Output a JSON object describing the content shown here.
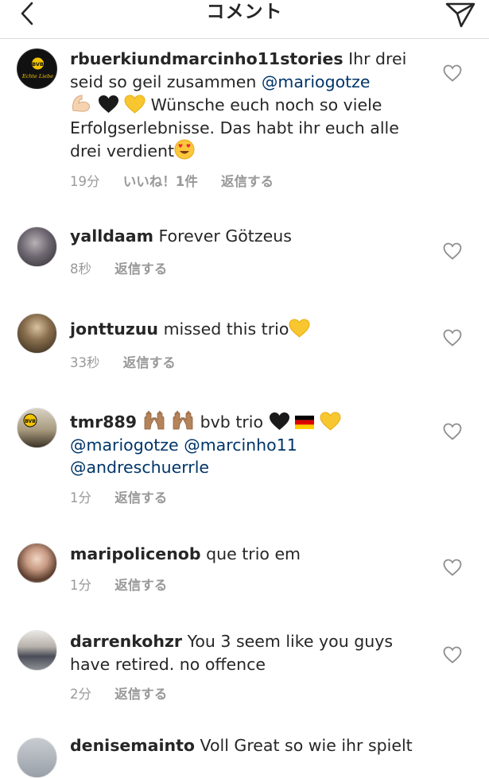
{
  "header": {
    "title": "コメント"
  },
  "icons": {
    "back": "chevron-left-icon",
    "send": "paper-plane-icon",
    "like": "heart-outline-icon"
  },
  "colors": {
    "mention": "#003569",
    "meta": "#999999",
    "text": "#262626",
    "divider": "#dbdbdb"
  },
  "comments": [
    {
      "username": "rbuerkiundmarcinho11stories",
      "text_1": "Ihr drei seid so geil zusammen",
      "mention_1": "@mariogotze",
      "text_2": "Wünsche euch noch so viele Erfolgserlebnisse. Das habt ihr euch alle drei verdient",
      "time": "19分",
      "likes": "いいね！1件",
      "reply": "返信する",
      "avatar_badge": "BVB",
      "avatar_caption": "Echte Liebe"
    },
    {
      "username": "yalldaam",
      "text_1": "Forever Götzeus",
      "time": "8秒",
      "reply": "返信する"
    },
    {
      "username": "jonttuzuu",
      "text_1": "missed this trio",
      "time": "33秒",
      "reply": "返信する"
    },
    {
      "username": "tmr889",
      "text_1": "bvb trio",
      "mention_1": "@mariogotze",
      "mention_2": "@marcinho11",
      "mention_3": "@andreschuerrle",
      "time": "1分",
      "reply": "返信する",
      "avatar_badge": "BVB"
    },
    {
      "username": "maripolicenob",
      "text_1": "que trio em",
      "time": "1分",
      "reply": "返信する"
    },
    {
      "username": "darrenkohzr",
      "text_1": "You 3 seem like you guys have retired. no offence",
      "time": "2分",
      "reply": "返信する"
    },
    {
      "username": "denisemainto",
      "text_1": "Voll Great so wie ihr spielt"
    }
  ]
}
